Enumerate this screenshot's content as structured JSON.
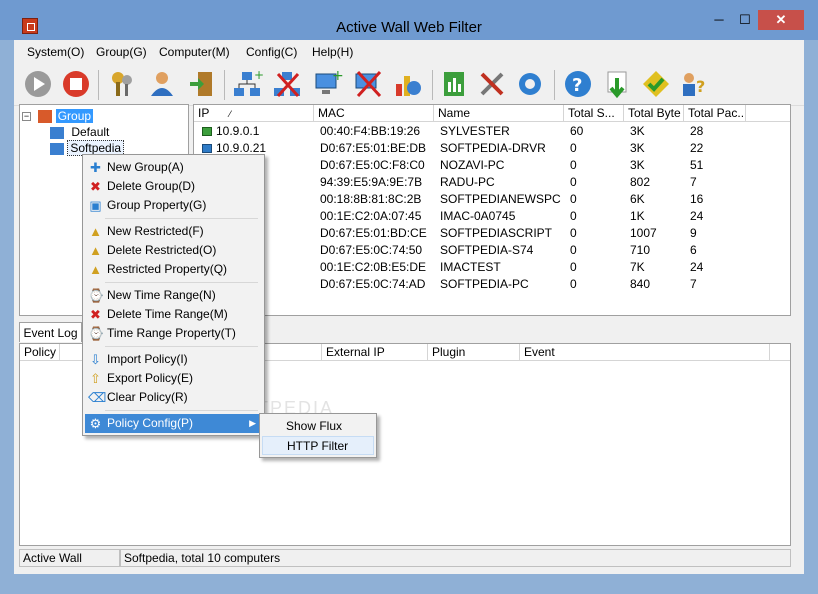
{
  "window": {
    "title": "Active Wall Web Filter",
    "minimize": "─",
    "maximize": "☐",
    "close": "✕"
  },
  "menu": [
    "System(O)",
    "Group(G)",
    "Computer(M)",
    "Config(C)",
    "Help(H)"
  ],
  "toolbar_icons": [
    "play-icon",
    "stop-icon",
    "keys-icon",
    "user-icon",
    "exit-door-icon",
    "add-network-icon",
    "delete-network-icon",
    "add-computer-icon",
    "delete-computer-icon",
    "chart-icon",
    "report-icon",
    "tools-icon",
    "settings-gear-icon",
    "help-icon",
    "download-icon",
    "check-icon",
    "user-help-icon"
  ],
  "tree": {
    "root": "Group",
    "children": [
      "Default",
      "Softpedia"
    ]
  },
  "list": {
    "columns": [
      "IP",
      "MAC",
      "Name",
      "Total S...",
      "Total Byte",
      "Total Pac..."
    ],
    "rows": [
      [
        "10.9.0.1",
        "00:40:F4:BB:19:26",
        "SYLVESTER",
        "60",
        "3K",
        "28"
      ],
      [
        "10.9.0.21",
        "D0:67:E5:01:BE:DB",
        "SOFTPEDIA-DRVR",
        "0",
        "3K",
        "22"
      ],
      [
        "",
        "D0:67:E5:0C:F8:C0",
        "NOZAVI-PC",
        "0",
        "3K",
        "51"
      ],
      [
        "",
        "94:39:E5:9A:9E:7B",
        "RADU-PC",
        "0",
        "802",
        "7"
      ],
      [
        "",
        "00:18:8B:81:8C:2B",
        "SOFTPEDIANEWSPC",
        "0",
        "6K",
        "16"
      ],
      [
        "",
        "00:1E:C2:0A:07:45",
        "IMAC-0A0745",
        "0",
        "1K",
        "24"
      ],
      [
        "",
        "D0:67:E5:01:BD:CE",
        "SOFTPEDIASCRIPT",
        "0",
        "1007",
        "9"
      ],
      [
        "",
        "D0:67:E5:0C:74:50",
        "SOFTPEDIA-S74",
        "0",
        "710",
        "6"
      ],
      [
        "",
        "00:1E:C2:0B:E5:DE",
        "IMACTEST",
        "0",
        "7K",
        "24"
      ],
      [
        "",
        "D0:67:E5:0C:74:AD",
        "SOFTPEDIA-PC",
        "0",
        "840",
        "7"
      ]
    ]
  },
  "tabs": {
    "event_log": "Event Log"
  },
  "log": {
    "columns": [
      "Policy",
      "External IP",
      "Plugin",
      "Event"
    ]
  },
  "status": {
    "left": "Active Wall",
    "right": "Softpedia, total 10 computers"
  },
  "context_menu": {
    "groups": [
      [
        "New Group(A)",
        "Delete Group(D)",
        "Group Property(G)"
      ],
      [
        "New Restricted(F)",
        "Delete Restricted(O)",
        "Restricted Property(Q)"
      ],
      [
        "New Time Range(N)",
        "Delete Time Range(M)",
        "Time Range Property(T)"
      ],
      [
        "Import Policy(I)",
        "Export Policy(E)",
        "Clear Policy(R)"
      ],
      [
        "Policy Config(P)"
      ]
    ]
  },
  "submenu": [
    "Show Flux",
    "HTTP Filter"
  ],
  "watermark": "SOFTPEDIA"
}
